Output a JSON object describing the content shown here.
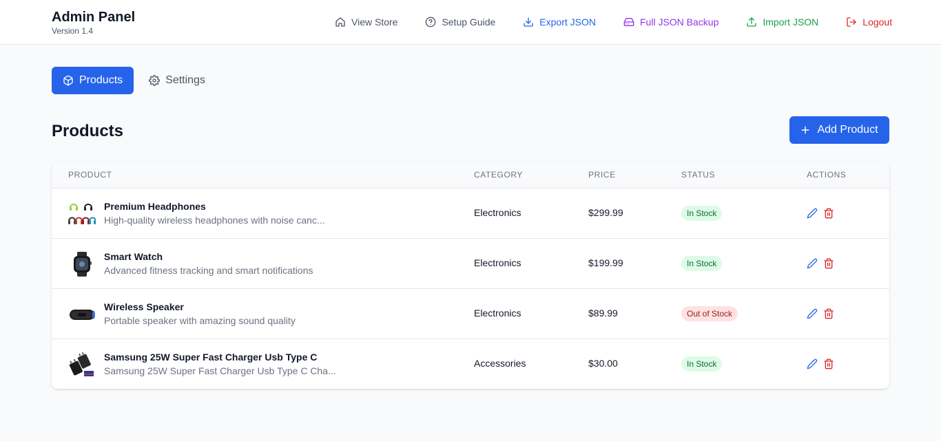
{
  "brand": {
    "title": "Admin Panel",
    "version": "Version 1.4"
  },
  "nav": {
    "view_store": "View Store",
    "setup_guide": "Setup Guide",
    "export_json": "Export JSON",
    "full_backup": "Full JSON Backup",
    "import_json": "Import JSON",
    "logout": "Logout"
  },
  "tabs": {
    "products": "Products",
    "settings": "Settings"
  },
  "page": {
    "title": "Products",
    "add_button": "Add Product"
  },
  "table": {
    "headers": {
      "product": "PRODUCT",
      "category": "CATEGORY",
      "price": "PRICE",
      "status": "STATUS",
      "actions": "ACTIONS"
    },
    "rows": [
      {
        "name": "Premium Headphones",
        "description": "High-quality wireless headphones with noise canc...",
        "category": "Electronics",
        "price": "$299.99",
        "status": "In Stock",
        "in_stock": true,
        "icon": "headphones-thumbnail"
      },
      {
        "name": "Smart Watch",
        "description": "Advanced fitness tracking and smart notifications",
        "category": "Electronics",
        "price": "$199.99",
        "status": "In Stock",
        "in_stock": true,
        "icon": "smartwatch-thumbnail"
      },
      {
        "name": "Wireless Speaker",
        "description": "Portable speaker with amazing sound quality",
        "category": "Electronics",
        "price": "$89.99",
        "status": "Out of Stock",
        "in_stock": false,
        "icon": "speaker-thumbnail"
      },
      {
        "name": "Samsung 25W Super Fast Charger Usb Type C",
        "description": "Samsung 25W Super Fast Charger Usb Type C Cha...",
        "category": "Accessories",
        "price": "$30.00",
        "status": "In Stock",
        "in_stock": true,
        "icon": "charger-thumbnail"
      }
    ]
  },
  "colors": {
    "primary": "#2563eb",
    "purple": "#9333ea",
    "green": "#16a34a",
    "red": "#dc2626",
    "gray": "#4b5563"
  }
}
